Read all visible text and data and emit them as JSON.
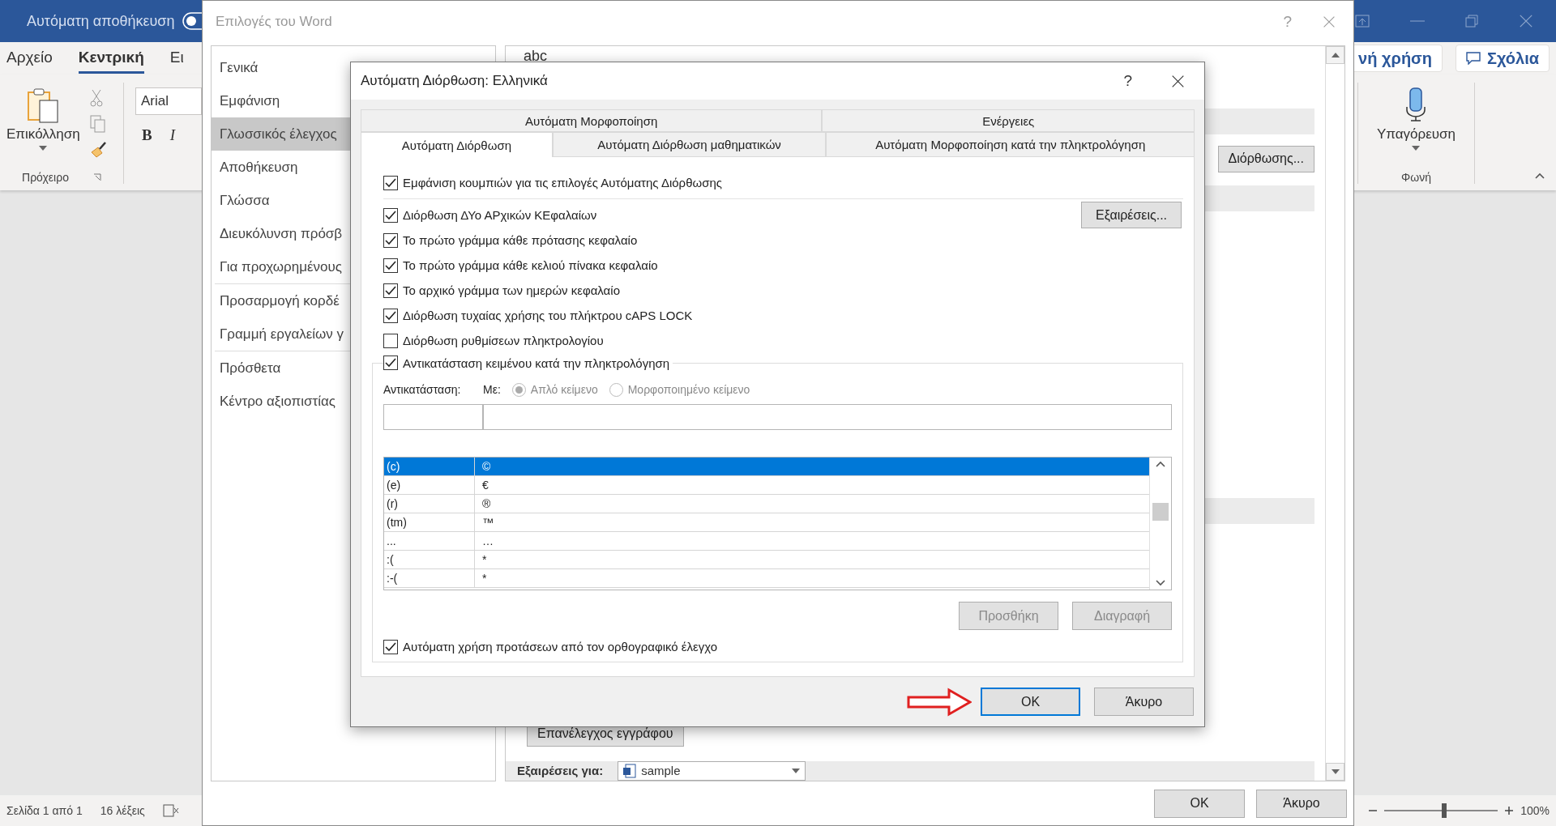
{
  "word": {
    "autosave_label": "Αυτόματη αποθήκευση",
    "autosave_on": false,
    "ribbon_tabs": [
      {
        "label": "Αρχείο",
        "selected": false
      },
      {
        "label": "Κεντρική",
        "selected": true
      },
      {
        "label": "Ει",
        "selected": false
      }
    ],
    "share_button": "νή χρήση",
    "comments_button": "Σχόλια",
    "paste_label": "Επικόλληση",
    "clipboard_group": "Πρόχειρο",
    "font_name": "Arial",
    "bold": "B",
    "italic": "I",
    "dictate_label": "Υπαγόρευση",
    "voice_group": "Φωνή",
    "status_bar": {
      "page": "Σελίδα 1 από 1",
      "words": "16 λέξεις",
      "zoom": "100%",
      "zoom_slider": {
        "level": 0.53
      }
    }
  },
  "options_dialog": {
    "title": "Επιλογές του Word",
    "help": "?",
    "nav": [
      {
        "label": "Γενικά",
        "selected": false
      },
      {
        "label": "Εμφάνιση",
        "selected": false
      },
      {
        "label": "Γλωσσικός έλεγχος",
        "selected": true
      },
      {
        "label": "Αποθήκευση",
        "selected": false
      },
      {
        "label": "Γλώσσα",
        "selected": false
      },
      {
        "label": "Διευκόλυνση πρόσβ",
        "selected": false
      },
      {
        "label": "Για προχωρημένους",
        "selected": false
      },
      {
        "label": "Προσαρμογή κορδέ",
        "selected": false
      },
      {
        "label": "Γραμμή εργαλείων γ",
        "selected": false
      },
      {
        "label": "Πρόσθετα",
        "selected": false
      },
      {
        "label": "Κέντρο αξιοπιστίας",
        "selected": false
      }
    ],
    "preview": "abc",
    "autocorrect_button": "Διόρθωσης...",
    "recheck_button": "Επανέλεγχος εγγράφου",
    "exceptions_label": "Εξαιρέσεις για:",
    "exceptions_document": "sample",
    "buttons": [
      "OK",
      "Άκυρο"
    ]
  },
  "autocorrect_dialog": {
    "title": "Αυτόματη Διόρθωση: Ελληνικά",
    "help": "?",
    "tabs_back": [
      {
        "label": "Αυτόματη Μορφοποίηση",
        "selected": false
      },
      {
        "label": "Ενέργειες",
        "selected": false
      }
    ],
    "tabs_front": [
      {
        "label": "Αυτόματη Διόρθωση",
        "selected": true
      },
      {
        "label": "Αυτόματη Διόρθωση μαθηματικών",
        "selected": false
      },
      {
        "label": "Αυτόματη Μορφοποίηση κατά την πληκτρολόγηση",
        "selected": false
      }
    ],
    "options": [
      {
        "label": "Εμφάνιση κουμπιών για τις επιλογές Αυτόματης Διόρθωσης",
        "checked": true
      },
      {
        "label": "Διόρθωση ΔΥο ΑΡχικών ΚΕφαλαίων",
        "checked": true
      },
      {
        "label": "Το πρώτο γράμμα κάθε πρότασης κεφαλαίο",
        "checked": true
      },
      {
        "label": "Το πρώτο γράμμα κάθε κελιού πίνακα κεφαλαίο",
        "checked": true
      },
      {
        "label": "Το αρχικό γράμμα των ημερών κεφαλαίο",
        "checked": true
      },
      {
        "label": "Διόρθωση τυχαίας χρήσης του πλήκτρου cAPS LOCK",
        "checked": true
      },
      {
        "label": "Διόρθωση ρυθμίσεων πληκτρολογίου",
        "checked": false
      }
    ],
    "exceptions_button": "Εξαιρέσεις...",
    "replace_group": {
      "label": "Αντικατάσταση κειμένου κατά την πληκτρολόγηση",
      "checked": true,
      "replace_label": "Αντικατάσταση:",
      "with_label": "Με:",
      "formats": [
        {
          "label": "Απλό κείμενο",
          "selected": true,
          "disabled": true
        },
        {
          "label": "Μορφοποιημένο κείμενο",
          "selected": false,
          "disabled": true
        }
      ]
    },
    "entries": [
      {
        "replace": "(c)",
        "with": "©",
        "selected": true
      },
      {
        "replace": "(e)",
        "with": "€",
        "selected": false
      },
      {
        "replace": "(r)",
        "with": "®",
        "selected": false
      },
      {
        "replace": "(tm)",
        "with": "™",
        "selected": false
      },
      {
        "replace": "...",
        "with": "…",
        "selected": false
      },
      {
        "replace": ":(",
        "with": "*",
        "selected": false
      },
      {
        "replace": ":-(",
        "with": "*",
        "selected": false
      }
    ],
    "list_buttons": [
      {
        "label": "Προσθήκη",
        "disabled": true
      },
      {
        "label": "Διαγραφή",
        "disabled": true
      }
    ],
    "spelling_option": {
      "label": "Αυτόματη χρήση προτάσεων από τον ορθογραφικό έλεγχο",
      "checked": true
    },
    "buttons": [
      {
        "label": "OK",
        "focused": true
      },
      {
        "label": "Άκυρο",
        "focused": false
      }
    ]
  }
}
